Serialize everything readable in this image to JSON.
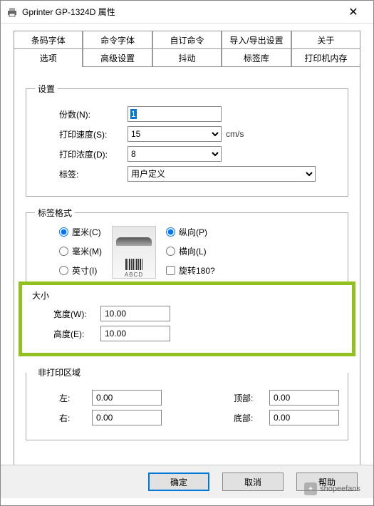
{
  "window": {
    "title": "Gprinter GP-1324D 属性"
  },
  "tabs": {
    "row1": [
      "条码字体",
      "命令字体",
      "自订命令",
      "导入/导出设置",
      "关于"
    ],
    "row2": [
      "选项",
      "高级设置",
      "抖动",
      "标签库",
      "打印机内存"
    ],
    "activeIndex": 0
  },
  "settings": {
    "legend": "设置",
    "copies": {
      "label": "份数(N):",
      "value": "1"
    },
    "speed": {
      "label": "打印速度(S):",
      "value": "15",
      "unit": "cm/s"
    },
    "density": {
      "label": "打印浓度(D):",
      "value": "8"
    },
    "stock": {
      "label": "标签:",
      "value": "用户定义"
    }
  },
  "labelFormat": {
    "legend": "标签格式",
    "unitOptions": {
      "cm": "厘米(C)",
      "mm": "毫米(M)",
      "inch": "英寸(I)"
    },
    "orientation": {
      "portrait": "纵向(P)",
      "landscape": "横向(L)",
      "rotate180": "旋转180?"
    },
    "previewText": "ABCD"
  },
  "size": {
    "legend": "大小",
    "width": {
      "label": "宽度(W):",
      "value": "10.00"
    },
    "height": {
      "label": "高度(E):",
      "value": "10.00"
    }
  },
  "nonPrint": {
    "legend": "非打印区域",
    "left": {
      "label": "左:",
      "value": "0.00"
    },
    "right": {
      "label": "右:",
      "value": "0.00"
    },
    "top": {
      "label": "顶部:",
      "value": "0.00"
    },
    "bottom": {
      "label": "底部:",
      "value": "0.00"
    }
  },
  "buttons": {
    "ok": "确定",
    "cancel": "取消",
    "help": "帮助"
  },
  "watermark": {
    "text": "shopeefans"
  }
}
